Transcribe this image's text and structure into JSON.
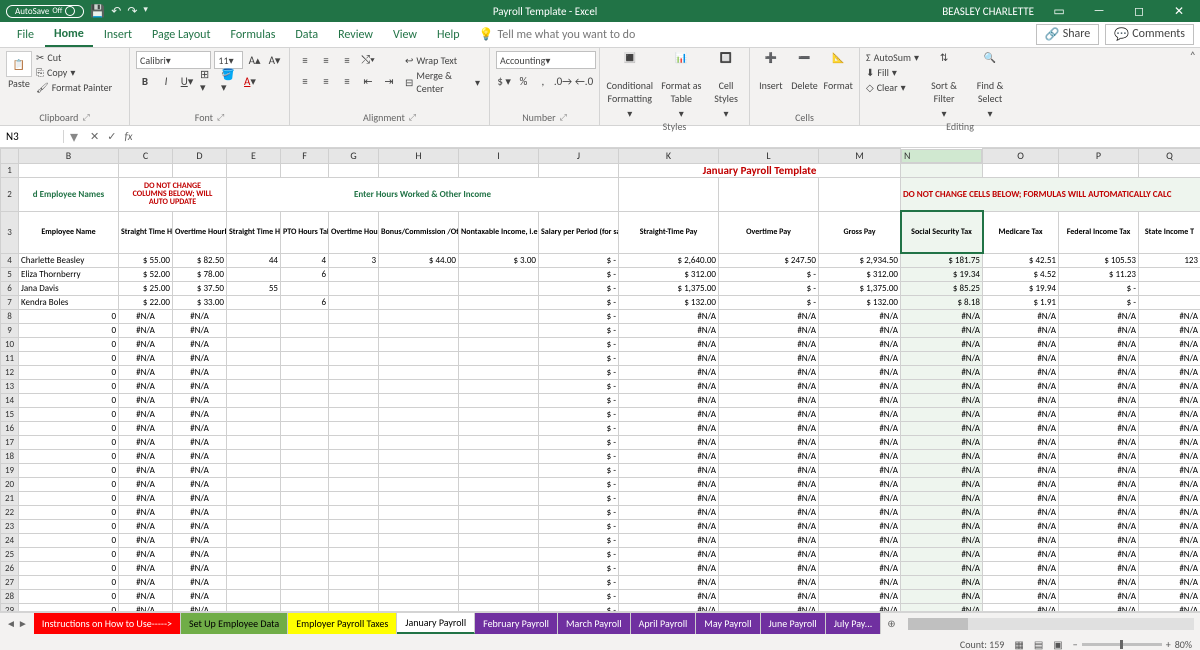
{
  "titlebar": {
    "autosave": "AutoSave",
    "doc": "Payroll Template - Excel",
    "user": "BEASLEY CHARLETTE"
  },
  "tabs": {
    "items": [
      "File",
      "Home",
      "Insert",
      "Page Layout",
      "Formulas",
      "Data",
      "Review",
      "View",
      "Help"
    ],
    "active": 1,
    "tell": "Tell me what you want to do",
    "share": "Share",
    "comments": "Comments"
  },
  "ribbon": {
    "clipboard": {
      "paste": "Paste",
      "cut": "Cut",
      "copy": "Copy",
      "fp": "Format Painter",
      "label": "Clipboard"
    },
    "font": {
      "name": "Calibri",
      "size": "11",
      "label": "Font"
    },
    "alignment": {
      "wrap": "Wrap Text",
      "merge": "Merge & Center",
      "label": "Alignment"
    },
    "number": {
      "fmt": "Accounting",
      "label": "Number"
    },
    "styles": {
      "cf": "Conditional Formatting",
      "fat": "Format as Table",
      "cs": "Cell Styles",
      "label": "Styles"
    },
    "cells": {
      "insert": "Insert",
      "delete": "Delete",
      "format": "Format",
      "label": "Cells"
    },
    "editing": {
      "autosum": "AutoSum",
      "fill": "Fill",
      "clear": "Clear",
      "sort": "Sort & Filter",
      "find": "Find & Select",
      "label": "Editing"
    }
  },
  "namebox": {
    "ref": "N3"
  },
  "cols": [
    "",
    "B",
    "C",
    "D",
    "E",
    "F",
    "G",
    "H",
    "I",
    "J",
    "K",
    "L",
    "M",
    "N",
    "O",
    "P",
    "Q"
  ],
  "sheet": {
    "title": "January Payroll Template",
    "warn1a": "DO NOT CHANGE",
    "warn1b": "COLUMNS BELOW; WILL",
    "warn1c": "AUTO UPDATE",
    "emp": "d Employee Names",
    "hours": "Enter Hours Worked & Other Income",
    "warn2": "DO NOT CHANGE CELLS BELOW; FORMULAS WILL AUTOMATICALLY CALC",
    "headers": {
      "b": "Employee Name",
      "c": "Straight Time Hourly Rate",
      "d": "Overtime Hourly Rate",
      "e": "Straight Time Hours Worked",
      "f": "PTO Hours Taken",
      "g": "Overtime Hours Worked",
      "h": "Bonus/Commission /Other Taxable Income",
      "i": "Nontaxable Income, i.e., Reimbursements",
      "j": "Salary per Period (for salaried workers only)",
      "k": "Straight-Time Pay",
      "l": "Overtime Pay",
      "m": "Gross Pay",
      "n": "Social Security Tax",
      "o": "Medicare Tax",
      "p": "Federal Income Tax",
      "q": "State Income T"
    },
    "rows": [
      {
        "n": 4,
        "b": "Charlette Beasley",
        "c": "55.00",
        "d": "82.50",
        "e": "44",
        "f": "4",
        "g": "3",
        "h": "44.00",
        "i": "3.00",
        "j": "-",
        "k": "2,640.00",
        "l": "247.50",
        "m": "2,934.50",
        "nn": "181.75",
        "o": "42.51",
        "p": "105.53",
        "q": "123"
      },
      {
        "n": 5,
        "b": "Eliza Thornberry",
        "c": "52.00",
        "d": "78.00",
        "e": "",
        "f": "6",
        "g": "",
        "h": "",
        "i": "",
        "j": "-",
        "k": "312.00",
        "l": "-",
        "m": "312.00",
        "nn": "19.34",
        "o": "4.52",
        "p": "11.23",
        "q": ""
      },
      {
        "n": 6,
        "b": "Jana Davis",
        "c": "25.00",
        "d": "37.50",
        "e": "55",
        "f": "",
        "g": "",
        "h": "",
        "i": "",
        "j": "-",
        "k": "1,375.00",
        "l": "-",
        "m": "1,375.00",
        "nn": "85.25",
        "o": "19.94",
        "p": "-",
        "q": ""
      },
      {
        "n": 7,
        "b": "Kendra Boles",
        "c": "22.00",
        "d": "33.00",
        "e": "",
        "f": "6",
        "g": "",
        "h": "",
        "i": "",
        "j": "-",
        "k": "132.00",
        "l": "-",
        "m": "132.00",
        "nn": "8.18",
        "o": "1.91",
        "p": "-",
        "q": ""
      }
    ],
    "na": "#N/A"
  },
  "sheets": [
    "Instructions on How to Use----->",
    "Set Up Employee Data",
    "Employer Payroll Taxes",
    "January Payroll",
    "February Payroll",
    "March Payroll",
    "April Payroll",
    "May Payroll",
    "June Payroll",
    "July Pay..."
  ],
  "status": {
    "count": "Count: 159",
    "zoom": "80%"
  }
}
